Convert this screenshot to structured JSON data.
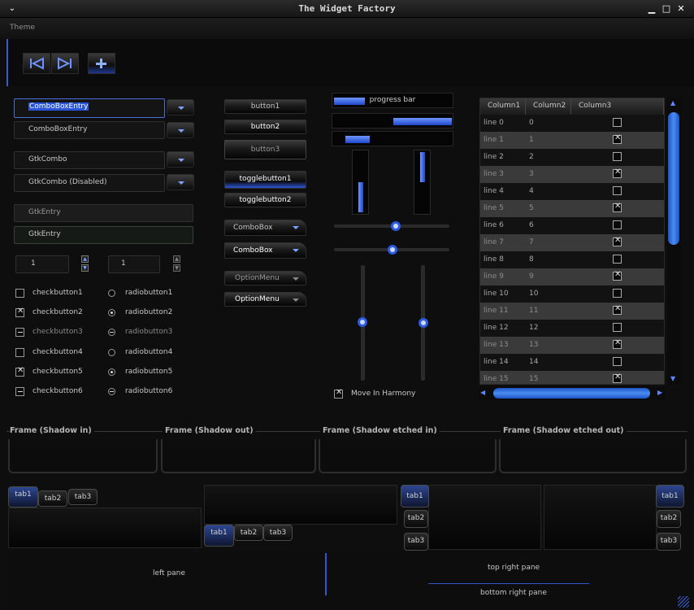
{
  "window": {
    "title": "The Widget Factory",
    "menu_icon": "chevron-down-icon",
    "min": "▁",
    "max": "□",
    "close": "✕"
  },
  "menu": {
    "theme": "Theme"
  },
  "toolbar": {
    "icons": [
      "go-first-icon",
      "go-last-icon",
      "add-icon"
    ]
  },
  "left": {
    "combo_entry_1": "ComboBoxEntry",
    "combo_entry_2": "ComboBoxEntry",
    "gtk_combo": "GtkCombo",
    "gtk_combo_disabled": "GtkCombo (Disabled)",
    "entry_1": "GtkEntry",
    "entry_2": "GtkEntry",
    "spin_1": "1",
    "spin_2": "1",
    "checks": [
      "checkbutton1",
      "checkbutton2",
      "checkbutton3",
      "checkbutton4",
      "checkbutton5",
      "checkbutton6"
    ],
    "radios": [
      "radiobutton1",
      "radiobutton2",
      "radiobutton3",
      "radiobutton4",
      "radiobutton5",
      "radiobutton6"
    ]
  },
  "middle": {
    "button1": "button1",
    "button2": "button2",
    "button3": "button3",
    "toggle1": "togglebutton1",
    "toggle2": "togglebutton2",
    "combobox1": "ComboBox",
    "combobox2": "ComboBox",
    "option1": "OptionMenu",
    "option2": "OptionMenu"
  },
  "progress": {
    "label": "progress bar",
    "value": 0.25,
    "harmony_label": "Move In Harmony"
  },
  "tree": {
    "columns": [
      "Column1",
      "Column2",
      "Column3"
    ],
    "rows": [
      {
        "c1": "line 0",
        "c2": "0",
        "checked": false
      },
      {
        "c1": "line 1",
        "c2": "1",
        "checked": true
      },
      {
        "c1": "line 2",
        "c2": "2",
        "checked": false
      },
      {
        "c1": "line 3",
        "c2": "3",
        "checked": true
      },
      {
        "c1": "line 4",
        "c2": "4",
        "checked": false
      },
      {
        "c1": "line 5",
        "c2": "5",
        "checked": true
      },
      {
        "c1": "line 6",
        "c2": "6",
        "checked": false
      },
      {
        "c1": "line 7",
        "c2": "7",
        "checked": true
      },
      {
        "c1": "line 8",
        "c2": "8",
        "checked": false
      },
      {
        "c1": "line 9",
        "c2": "9",
        "checked": true
      },
      {
        "c1": "line 10",
        "c2": "10",
        "checked": false
      },
      {
        "c1": "line 11",
        "c2": "11",
        "checked": true
      },
      {
        "c1": "line 12",
        "c2": "12",
        "checked": false
      },
      {
        "c1": "line 13",
        "c2": "13",
        "checked": true
      },
      {
        "c1": "line 14",
        "c2": "14",
        "checked": false
      },
      {
        "c1": "line 15",
        "c2": "15",
        "checked": true
      }
    ]
  },
  "frames": [
    "Frame (Shadow in)",
    "Frame (Shadow out)",
    "Frame (Shadow etched in)",
    "Frame (Shadow etched out)"
  ],
  "tabs": [
    "tab1",
    "tab2",
    "tab3"
  ],
  "panes": {
    "left": "left pane",
    "top_right": "top right pane",
    "bottom_right": "bottom right pane"
  },
  "colors": {
    "accent": "#3d6cf0",
    "background": "#0e0e0e"
  }
}
